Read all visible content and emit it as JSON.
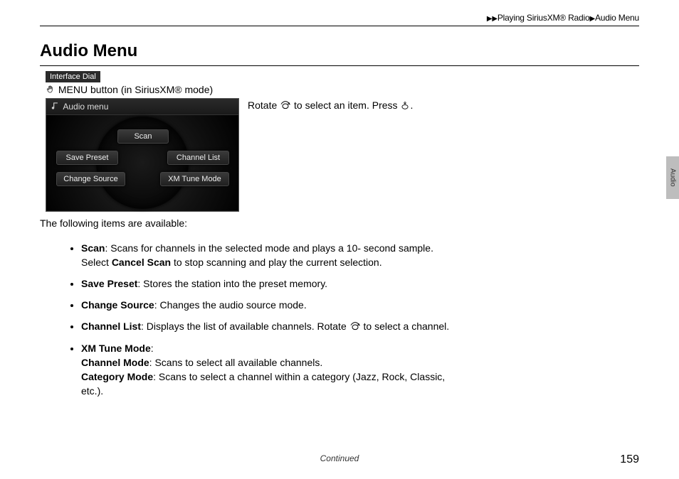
{
  "breadcrumb": {
    "section": "Playing SiriusXM® Radio",
    "page": "Audio Menu"
  },
  "title": "Audio Menu",
  "badge": "Interface Dial",
  "menu_button": "MENU button (in SiriusXM® mode)",
  "screenshot": {
    "header": "Audio menu",
    "scan": "Scan",
    "save_preset": "Save Preset",
    "channel_list": "Channel List",
    "change_source": "Change Source",
    "xm_tune_mode": "XM Tune Mode"
  },
  "instruction": {
    "rotate": "Rotate ",
    "select": " to select an item. Press ",
    "end": "."
  },
  "intro": "The following items are available:",
  "items": {
    "scan": {
      "label": "Scan",
      "text": ": Scans for channels in the selected mode and plays a 10- second sample. Select ",
      "cancel": "Cancel Scan",
      "text2": " to stop scanning and play the current selection."
    },
    "save": {
      "label": "Save Preset",
      "text": ": Stores the station into the preset memory."
    },
    "change": {
      "label": "Change Source",
      "text": ": Changes the audio source mode."
    },
    "clist": {
      "label": "Channel List",
      "text": ": Displays the list of available channels. Rotate ",
      "text2": " to select a channel."
    },
    "xm": {
      "label": "XM Tune Mode",
      "colon": ":",
      "ch_label": "Channel Mode",
      "ch_text": ": Scans to select all available channels.",
      "cat_label": "Category Mode",
      "cat_text": ": Scans to select a channel within a category (Jazz, Rock, Classic, etc.)."
    }
  },
  "side_tab": "Audio",
  "continued": "Continued",
  "page_number": "159"
}
